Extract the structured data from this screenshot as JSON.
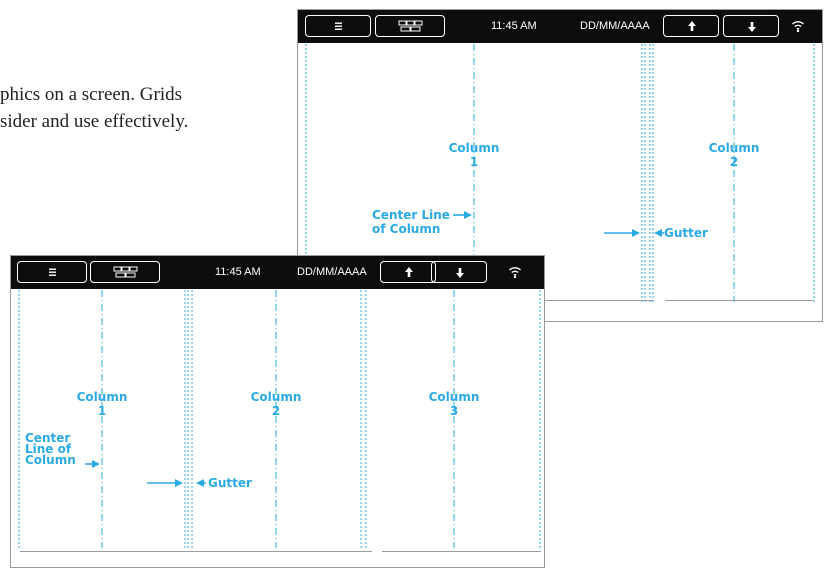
{
  "background_text": {
    "line1": "phics on a screen. Grids",
    "line2": "sider and use effectively."
  },
  "status_bar": {
    "time": "11:45 AM",
    "date": "DD/MM/AAAA",
    "icons": [
      "menu-icon",
      "grid-layout-icon",
      "arrow-up-icon",
      "arrow-down-icon",
      "wifi-icon"
    ]
  },
  "screen_back": {
    "columns": [
      {
        "word": "Column",
        "number": "1"
      },
      {
        "word": "Column",
        "number": "2"
      }
    ],
    "center_line_label": {
      "line1": "Center Line",
      "line2": "of Column"
    },
    "gutter_label": "Gutter"
  },
  "screen_front": {
    "columns": [
      {
        "word": "Column",
        "number": "1"
      },
      {
        "word": "Column",
        "number": "2"
      },
      {
        "word": "Column",
        "number": "3"
      }
    ],
    "center_line_label": {
      "line1": "Center",
      "line2": "Line of",
      "line3": "Column"
    },
    "gutter_label": "Gutter"
  },
  "colors": {
    "accent": "#2aaae2",
    "status_bar": "#0d0d0d",
    "frame": "#9a9a9a"
  }
}
